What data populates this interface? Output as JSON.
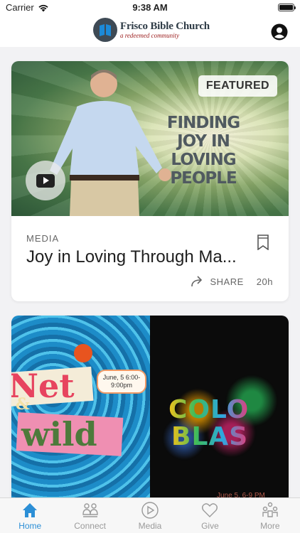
{
  "status_bar": {
    "carrier": "Carrier",
    "time": "9:38 AM"
  },
  "header": {
    "church_name": "Frisco Bible Church",
    "tagline": "a redeemed community"
  },
  "feed": {
    "cards": [
      {
        "badge": "FEATURED",
        "thumb_title": "FINDING JOY IN LOVING PEOPLE",
        "category": "MEDIA",
        "title": "Joy in Loving Through Ma...",
        "share_label": "SHARE",
        "age": "20h"
      },
      {
        "left": {
          "line1": "Net",
          "amp": "&",
          "line2": "wild",
          "date": "June, 5 6:00-9:00pm"
        },
        "right": {
          "line1": "COLO",
          "line2": "BLAS",
          "date": "June 5, 6-9 PM"
        }
      }
    ]
  },
  "tabs": [
    {
      "label": "Home",
      "icon": "home-icon",
      "active": true
    },
    {
      "label": "Connect",
      "icon": "people-icon",
      "active": false
    },
    {
      "label": "Media",
      "icon": "play-circle-icon",
      "active": false
    },
    {
      "label": "Give",
      "icon": "heart-icon",
      "active": false
    },
    {
      "label": "More",
      "icon": "group-icon",
      "active": false
    }
  ],
  "colors": {
    "accent": "#2c8fd6",
    "inactive": "#9a9a9a",
    "brand": "#2e3b46",
    "tagline": "#9b1c1c"
  }
}
